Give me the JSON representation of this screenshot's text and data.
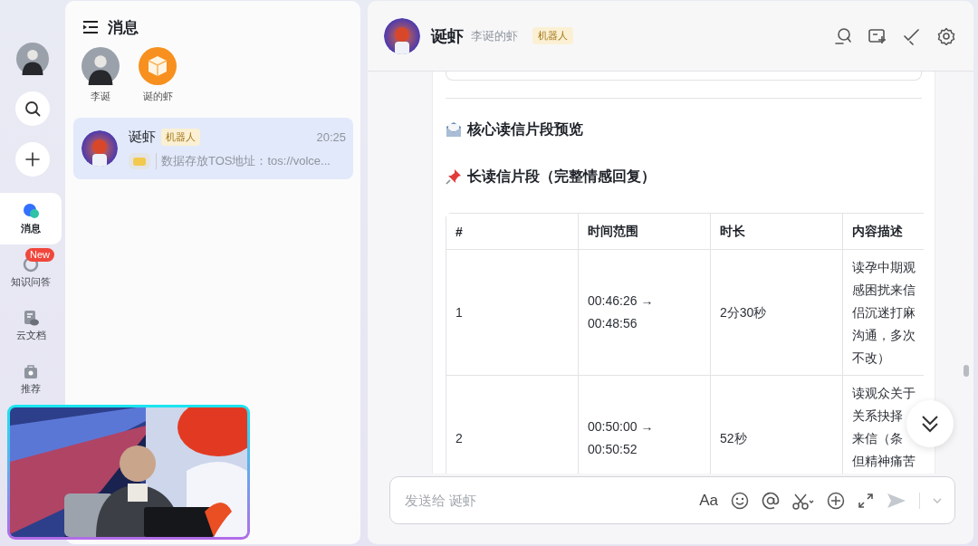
{
  "rail": {
    "nav": [
      {
        "label": "消息",
        "selected": true,
        "kind": "chat"
      },
      {
        "label": "知识问答",
        "selected": false,
        "kind": "ring",
        "badge": "New"
      },
      {
        "label": "云文档",
        "selected": false,
        "kind": "doc"
      },
      {
        "label": "推荐",
        "selected": false,
        "kind": "bag"
      }
    ]
  },
  "list": {
    "title": "消息",
    "pinned": [
      {
        "name": "李诞",
        "kind": "person"
      },
      {
        "name": "诞的虾",
        "kind": "box"
      }
    ],
    "chats": [
      {
        "name": "诞虾",
        "tag": "机器人",
        "time": "20:25",
        "preview": "数据存放TOS地址：tos://volce...",
        "selected": true
      }
    ]
  },
  "chat": {
    "title": "诞虾",
    "subtitle": "李诞的虾",
    "tag": "机器人",
    "heading": "核心读信片段预览",
    "subheading": "长读信片段（完整情感回复）",
    "table": {
      "columns": [
        "#",
        "时间范围",
        "时长",
        "内容描述"
      ],
      "rows": [
        {
          "cells": [
            "1",
            "00:46:26 →\n00:48:56",
            "2分30秒",
            [
              "读孕中期观",
              "感困扰来信",
              "侣沉迷打麻",
              "沟通，多次",
              "不改）"
            ]
          ]
        },
        {
          "cells": [
            "2",
            "00:50:00 →\n00:50:52",
            "52秒",
            [
              "读观众关于",
              "关系抉择",
              "来信（条",
              "但精神痛苦"
            ]
          ]
        }
      ]
    },
    "input": {
      "placeholder": "发送给 诞虾",
      "format_label": "Aa"
    }
  }
}
